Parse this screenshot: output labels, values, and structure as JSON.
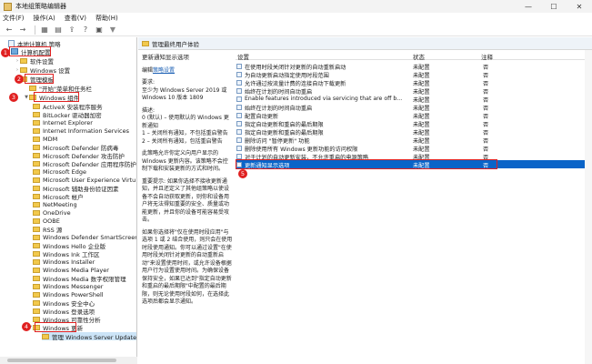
{
  "window": {
    "title": "本地组策略编辑器",
    "controls": {
      "minimize": "—",
      "maximize": "☐",
      "close": "✕"
    }
  },
  "menu": [
    "文件(F)",
    "操作(A)",
    "查看(V)",
    "帮助(H)"
  ],
  "toolbar": {
    "back": "←",
    "forward": "→",
    "buttons": [
      "▦",
      "▤",
      "⇪",
      "?",
      "▣"
    ],
    "filter": "▼"
  },
  "tree": {
    "items": [
      {
        "label": "本地计算机 策略",
        "icon": "pc-icon"
      },
      {
        "label": "计算机配置",
        "icon": "pc-icon"
      },
      {
        "label": "软件设置",
        "icon": "folder-icon"
      },
      {
        "label": "Windows 设置",
        "icon": "folder-icon"
      },
      {
        "label": "管理模板",
        "icon": "folder-icon"
      },
      {
        "label": "\"开始\"菜单和任务栏",
        "icon": "folder-icon"
      },
      {
        "label": "Windows 组件",
        "icon": "folder-icon"
      },
      {
        "label": "ActiveX 安装程序服务",
        "icon": "folder-icon"
      },
      {
        "label": "BitLocker 驱动器加密",
        "icon": "folder-icon"
      },
      {
        "label": "Internet Explorer",
        "icon": "folder-icon"
      },
      {
        "label": "Internet Information Services",
        "icon": "folder-icon"
      },
      {
        "label": "MDM",
        "icon": "folder-icon"
      },
      {
        "label": "Microsoft Defender 防病毒",
        "icon": "folder-icon"
      },
      {
        "label": "Microsoft Defender 攻击防护",
        "icon": "folder-icon"
      },
      {
        "label": "Microsoft Defender 应用程序防护",
        "icon": "folder-icon"
      },
      {
        "label": "Microsoft Edge",
        "icon": "folder-icon"
      },
      {
        "label": "Microsoft User Experience Virtu",
        "icon": "folder-icon"
      },
      {
        "label": "Microsoft 辅助身份验证因素",
        "icon": "folder-icon"
      },
      {
        "label": "Microsoft 帐户",
        "icon": "folder-icon"
      },
      {
        "label": "NetMeeting",
        "icon": "folder-icon"
      },
      {
        "label": "OneDrive",
        "icon": "folder-icon"
      },
      {
        "label": "OOBE",
        "icon": "folder-icon"
      },
      {
        "label": "RSS 源",
        "icon": "folder-icon"
      },
      {
        "label": "Windows Defender SmartScreen",
        "icon": "folder-icon"
      },
      {
        "label": "Windows Hello 企业版",
        "icon": "folder-icon"
      },
      {
        "label": "Windows Ink 工作区",
        "icon": "folder-icon"
      },
      {
        "label": "Windows Installer",
        "icon": "folder-icon"
      },
      {
        "label": "Windows Media Player",
        "icon": "folder-icon"
      },
      {
        "label": "Windows Media 数字权限管理",
        "icon": "folder-icon"
      },
      {
        "label": "Windows Messenger",
        "icon": "folder-icon"
      },
      {
        "label": "Windows PowerShell",
        "icon": "folder-icon"
      },
      {
        "label": "Windows 安全中心",
        "icon": "folder-icon"
      },
      {
        "label": "Windows 登录选项",
        "icon": "folder-icon"
      },
      {
        "label": "Windows 可靠性分析",
        "icon": "folder-icon"
      },
      {
        "label": "Windows 更新",
        "icon": "folder-icon"
      },
      {
        "label": "管理 Windows Server Update",
        "icon": "folder-icon"
      }
    ],
    "markers": [
      "1",
      "2",
      "3",
      "4"
    ]
  },
  "right": {
    "header": "管理最终用户体验",
    "description": {
      "heading": "更新通知显示选项",
      "edit_prefix": "编辑",
      "edit_link": "策略设置",
      "requirements_label": "要求:",
      "requirements_text": "至少为 Windows Server 2019 或 Windows 10 版本 1809",
      "desc_label": "描述:",
      "desc_text": "0 (默认) – 使用默认的 Windows 更新通知\n1 – 关闭所有通知，不包括重启警告\n2 – 关闭所有通知，包括重启警告",
      "para1": "此策略允许你定义向用户显示的 Windows 更新内容。该策略不会控制下载和安装更新的方式和时间。",
      "para2": "重要提示: 如果你选择不接收更新通知，并且还定义了其他组策略以使设备不会自动获取更新，则你和设备用户将无法得知重要的安全、质量或功能更新，并且你的设备可能容易受攻击。",
      "para3": "如果你选择将\"仅在使用时段应用\"与选项 1 或 2 结合使用，则只会在使用时段使用通知。你可以通过设置\"在使用时段关闭针对更新的自动重新启动\"来设置使用时间，或允许设备根据用户行为设置使用时间。为确保设备保持安全，如果已达到\"指定自动更新和重启的最后期限\"中配置的最后期限，则无论使用时段如何，在选择此选项后都会显示通知。"
    },
    "list": {
      "columns": [
        "设置",
        "状态",
        "注释"
      ],
      "rows": [
        {
          "name": "在使用时段关闭针对更新的自动重新启动",
          "state": "未配置",
          "note": "否"
        },
        {
          "name": "为自动更新启动指定使用时段范围",
          "state": "未配置",
          "note": "否"
        },
        {
          "name": "允许通过按流量计费的连接自动下载更新",
          "state": "未配置",
          "note": "否"
        },
        {
          "name": "始终在计划的时间自动重启",
          "state": "未配置",
          "note": "否"
        },
        {
          "name": "Enable features introduced via servicing that are off b...",
          "state": "未配置",
          "note": "否"
        },
        {
          "name": "始终在计划的时间自动重启",
          "state": "未配置",
          "note": "否"
        },
        {
          "name": "配置自动更新",
          "state": "未配置",
          "note": "否"
        },
        {
          "name": "指定自动更新和重启的最后期限",
          "state": "未配置",
          "note": "否"
        },
        {
          "name": "指定自动更新和重启的最后期限",
          "state": "未配置",
          "note": "否"
        },
        {
          "name": "删除访问 \"暂停更新\" 功能",
          "state": "未配置",
          "note": "否"
        },
        {
          "name": "删除使用所有 Windows 更新功能的访问权限",
          "state": "未配置",
          "note": "否"
        },
        {
          "name": "对于计划的自动更新安装，不允许重启的电源策略",
          "state": "未配置",
          "note": "否"
        },
        {
          "name": "更新通知显示选项",
          "state": "未配置",
          "note": "否"
        }
      ],
      "selected_index": 12,
      "marker": "5"
    }
  },
  "colors": {
    "accent": "#0a64c8",
    "marker": "#e02020",
    "selection_tree": "#cce4f7"
  }
}
